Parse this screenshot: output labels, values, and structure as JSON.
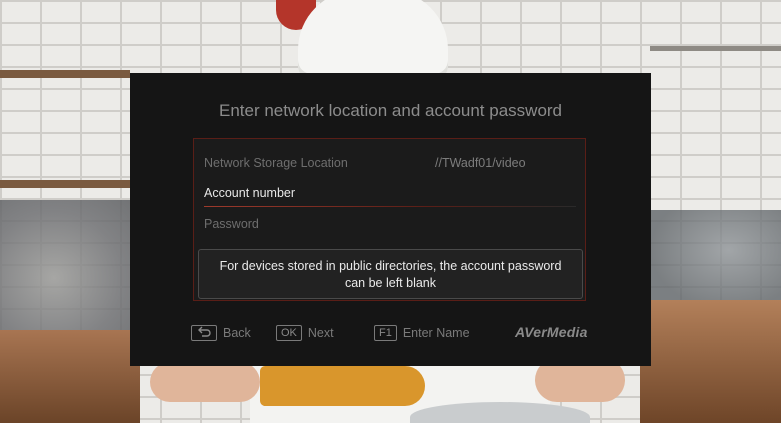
{
  "dialog": {
    "title": "Enter network location and account password",
    "fields": {
      "storage_label": "Network Storage Location",
      "storage_value": "//TWadf01/video",
      "account_label": "Account number",
      "password_label": "Password"
    },
    "info_text_line1": "For devices stored in public directories, the account password",
    "info_text_line2": "can be left blank"
  },
  "footer": {
    "back_label": "Back",
    "ok_key": "OK",
    "next_label": "Next",
    "f1_key": "F1",
    "name_label": "Enter Name",
    "brand": "AVerMedia"
  },
  "icons": {
    "back": "return-arrow-icon"
  },
  "colors": {
    "dialog_bg": "#151515",
    "accent_line": "#9e3a2c"
  }
}
